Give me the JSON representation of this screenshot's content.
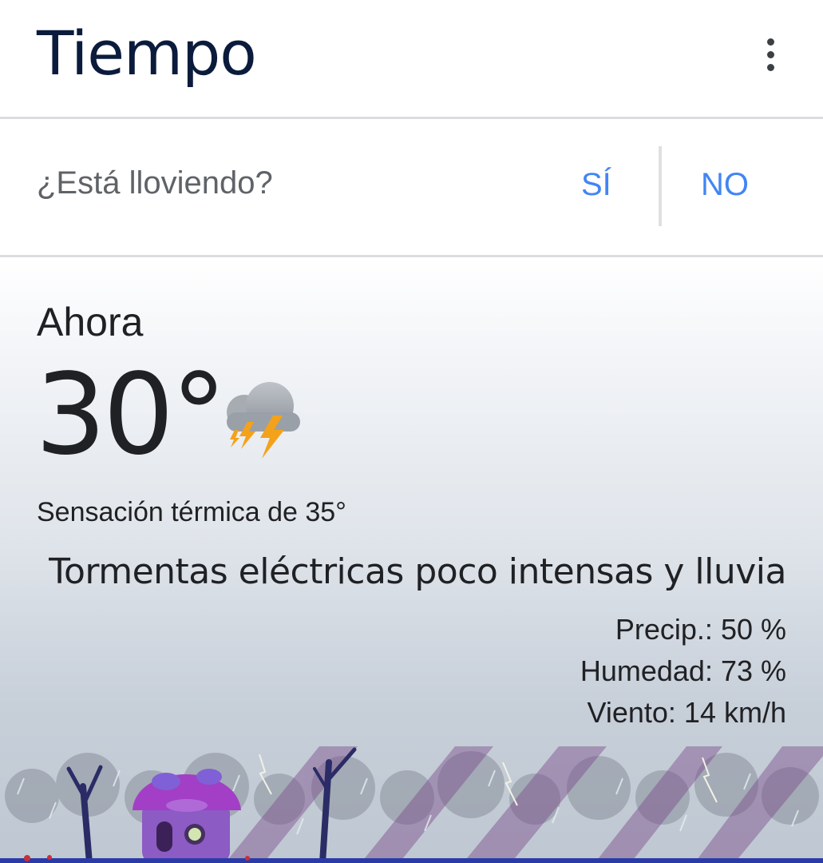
{
  "header": {
    "title": "Tiempo",
    "menu_icon": "more-vertical-icon"
  },
  "rain_question": {
    "text": "¿Está lloviendo?",
    "yes_label": "SÍ",
    "no_label": "NO"
  },
  "current": {
    "label": "Ahora",
    "temperature": "30°",
    "condition_icon": "thunderstorm-icon",
    "feels_like": "Sensación térmica de 35°",
    "condition": "Tormentas eléctricas poco intensas y lluvia",
    "precip": "Precip.: 50 %",
    "humidity": "Humedad: 73 %",
    "wind": "Viento: 14 km/h"
  },
  "colors": {
    "title": "#0b1b3c",
    "accent": "#4285f4",
    "text": "#202124",
    "muted": "#5f6368",
    "divider": "#dadce0",
    "bolt": "#f4a21a",
    "mushroom": "#9b3fc0",
    "ground": "#2a3ba8"
  }
}
